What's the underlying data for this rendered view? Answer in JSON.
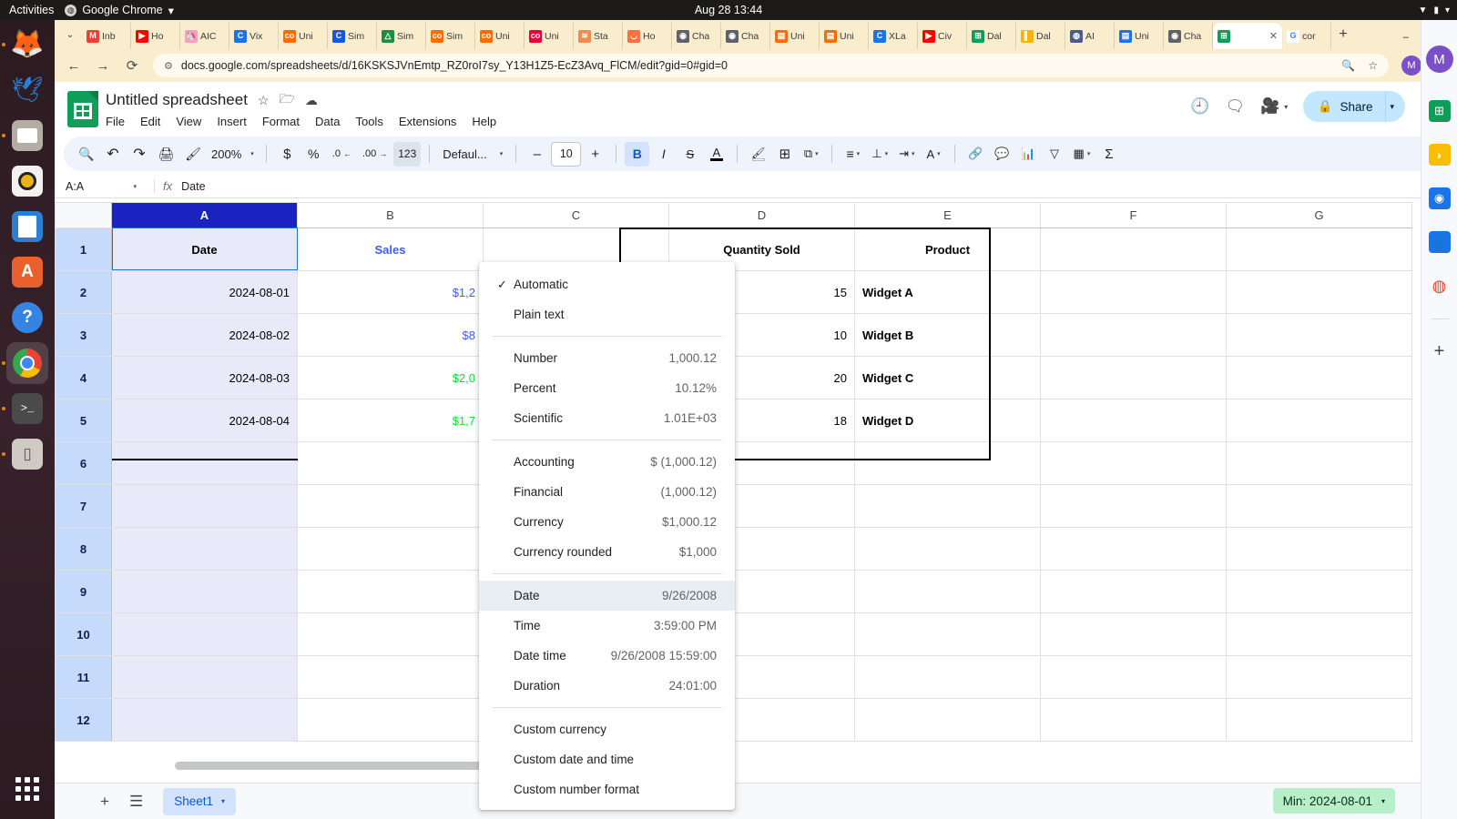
{
  "gnome": {
    "activities": "Activities",
    "app_name": "Google Chrome",
    "app_caret": "▾",
    "clock": "Aug 28  13:44",
    "tray": [
      "▼",
      "▮",
      "▾"
    ]
  },
  "dock": {
    "items": [
      {
        "name": "firefox-icon",
        "glyph": "🦊",
        "running": true,
        "active": false
      },
      {
        "name": "thunderbird-icon",
        "glyph": "🕊",
        "running": false,
        "active": false
      },
      {
        "name": "files-icon",
        "glyph": "📁",
        "running": true,
        "active": false
      },
      {
        "name": "rhythmbox-icon",
        "glyph": "◎",
        "running": false,
        "active": false
      },
      {
        "name": "libreoffice-writer-icon",
        "glyph": "📄",
        "running": false,
        "active": false
      },
      {
        "name": "ubuntu-software-icon",
        "glyph": "A",
        "running": false,
        "active": false
      },
      {
        "name": "help-icon",
        "glyph": "?",
        "running": false,
        "active": false
      },
      {
        "name": "google-chrome-icon",
        "glyph": "◍",
        "running": true,
        "active": true
      },
      {
        "name": "terminal-icon",
        "glyph": ">_",
        "running": true,
        "active": false
      },
      {
        "name": "archive-manager-icon",
        "glyph": "🗜",
        "running": true,
        "active": false
      }
    ],
    "show_apps_label": "Show Applications"
  },
  "browser": {
    "tab_search_glyph": "⌄",
    "tabs": [
      {
        "label": "Inb",
        "fav": "M",
        "color": "#ea4335",
        "active": false
      },
      {
        "label": "Ho",
        "fav": "▶",
        "color": "#ff0000",
        "active": false
      },
      {
        "label": "AIC",
        "fav": "🦄",
        "color": "#f5a0c0",
        "active": false
      },
      {
        "label": "Vix",
        "fav": "C",
        "color": "#1a73e8",
        "active": false
      },
      {
        "label": "Uni",
        "fav": "co",
        "color": "#ff6d00",
        "active": false
      },
      {
        "label": "Sim",
        "fav": "C",
        "color": "#1a56db",
        "active": false
      },
      {
        "label": "Sim",
        "fav": "△",
        "color": "#1e8e3e",
        "active": false
      },
      {
        "label": "Sim",
        "fav": "co",
        "color": "#ff6d00",
        "active": false
      },
      {
        "label": "Uni",
        "fav": "co",
        "color": "#ff6d00",
        "active": false
      },
      {
        "label": "Uni",
        "fav": "co",
        "color": "#e8003c",
        "active": false
      },
      {
        "label": "Sta",
        "fav": "≋",
        "color": "#f28b50",
        "active": false
      },
      {
        "label": "Ho",
        "fav": "◡",
        "color": "#ff7043",
        "active": false
      },
      {
        "label": "Cha",
        "fav": "◉",
        "color": "#5f6368",
        "active": false
      },
      {
        "label": "Cha",
        "fav": "◉",
        "color": "#5f6368",
        "active": false
      },
      {
        "label": "Uni",
        "fav": "▤",
        "color": "#ff6d00",
        "active": false
      },
      {
        "label": "Uni",
        "fav": "▤",
        "color": "#ff6d00",
        "active": false
      },
      {
        "label": "XLa",
        "fav": "C",
        "color": "#1a73e8",
        "active": false
      },
      {
        "label": "Civ",
        "fav": "▶",
        "color": "#ff0000",
        "active": false
      },
      {
        "label": "Dal",
        "fav": "⊞",
        "color": "#0f9d58",
        "active": false
      },
      {
        "label": "Dal",
        "fav": "▌",
        "color": "#f4b400",
        "active": false
      },
      {
        "label": "AI ",
        "fav": "◍",
        "color": "#4a5b8c",
        "active": false
      },
      {
        "label": "Uni",
        "fav": "▤",
        "color": "#1a73e8",
        "active": false
      },
      {
        "label": "Cha",
        "fav": "◉",
        "color": "#5f6368",
        "active": false
      },
      {
        "label": "",
        "fav": "⊞",
        "color": "#0f9d58",
        "active": true
      },
      {
        "label": "cor",
        "fav": "G",
        "color": "#ffffff",
        "active": false
      }
    ],
    "active_tab_close": "✕",
    "new_tab_glyph": "+",
    "window_buttons": [
      "–",
      "❐",
      "✕"
    ],
    "nav": {
      "back": "←",
      "forward": "→",
      "reload": "⟳",
      "site_info_icon": "site-info-icon",
      "url": "docs.google.com/spreadsheets/d/16KSKSJVnEmtp_RZ0roI7sy_Y13H1Z5-EcZ3Avq_FlCM/edit?gid=0#gid=0",
      "zoom_icon": "🔍",
      "bookmark_icon": "☆",
      "profile_initial": "M",
      "menu_glyph": "⋮"
    }
  },
  "sheets": {
    "doc_title": "Untitled spreadsheet",
    "title_icons": [
      {
        "name": "star-icon",
        "glyph": "☆"
      },
      {
        "name": "move-to-folder-icon",
        "glyph": "🗁"
      },
      {
        "name": "cloud-saved-icon",
        "glyph": "☁"
      }
    ],
    "menus": [
      "File",
      "Edit",
      "View",
      "Insert",
      "Format",
      "Data",
      "Tools",
      "Extensions",
      "Help"
    ],
    "header_right": {
      "version_history_icon": "🕘",
      "comment_icon": "🗨",
      "meet_icon": "🎥",
      "meet_caret": "▾",
      "share_lock_icon": "🔒",
      "share_label": "Share",
      "share_caret": "▾",
      "avatar_initial": "M"
    },
    "toolbar": {
      "search": "🔍",
      "undo": "↶",
      "redo": "↷",
      "print": "🖨",
      "paint_format": "🖌",
      "zoom_value": "200%",
      "zoom_caret": "▾",
      "currency": "$",
      "percent": "%",
      "decrease_decimal": ".0",
      "increase_decimal": ".00",
      "more_formats": "123",
      "font_family": "Defaul...",
      "font_caret": "▾",
      "font_decrease": "–",
      "font_size": "10",
      "font_increase": "+",
      "bold": "B",
      "italic": "I",
      "strikethrough": "S",
      "text_color": "A",
      "fill_color": "🖌",
      "borders": "⊞",
      "merge_cells": "⧉",
      "merge_caret": "▾",
      "h_align": "≡",
      "h_align_caret": "▾",
      "v_align": "⊥",
      "v_align_caret": "▾",
      "text_wrap": "⇥",
      "wrap_caret": "▾",
      "text_rotation": "A",
      "rotation_caret": "▾",
      "insert_link": "🔗",
      "insert_comment": "💬",
      "insert_chart": "📊",
      "create_filter": "▽",
      "functions_table": "▦",
      "table_caret": "▾",
      "sigma": "Σ",
      "collapse": "⌃"
    },
    "formula_bar": {
      "name_box": "A:A",
      "name_box_caret": "▾",
      "fx": "fx",
      "formula_value": "Date"
    },
    "grid": {
      "columns": [
        "A",
        "B",
        "C",
        "D",
        "E",
        "F",
        "G"
      ],
      "selected_column": "A",
      "rows": [
        "1",
        "2",
        "3",
        "4",
        "5",
        "6",
        "7",
        "8",
        "9",
        "10",
        "11",
        "12"
      ],
      "selected_rows": [
        "1",
        "2",
        "3",
        "4",
        "5",
        "6",
        "7",
        "8",
        "9",
        "10",
        "11",
        "12"
      ],
      "data": [
        {
          "row": "1",
          "A": "Date",
          "B": "Sales",
          "D": "Quantity Sold",
          "E": "Product"
        },
        {
          "row": "2",
          "A": "2024-08-01",
          "B": "$1,2",
          "D": "15",
          "E": "Widget A"
        },
        {
          "row": "3",
          "A": "2024-08-02",
          "B": "$8",
          "D": "10",
          "E": "Widget B"
        },
        {
          "row": "4",
          "A": "2024-08-03",
          "B": "$2,0",
          "D": "20",
          "E": "Widget C"
        },
        {
          "row": "5",
          "A": "2024-08-04",
          "B": "$1,7",
          "D": "18",
          "E": "Widget D"
        },
        {
          "row": "6",
          "A": "",
          "B": "",
          "D": "",
          "E": ""
        },
        {
          "row": "7",
          "A": "",
          "B": "",
          "D": "",
          "E": ""
        },
        {
          "row": "8",
          "A": "",
          "B": "",
          "D": "",
          "E": ""
        },
        {
          "row": "9",
          "A": "",
          "B": "",
          "D": "",
          "E": ""
        },
        {
          "row": "10",
          "A": "",
          "B": "",
          "D": "",
          "E": ""
        },
        {
          "row": "11",
          "A": "",
          "B": "",
          "D": "",
          "E": ""
        },
        {
          "row": "12",
          "A": "",
          "B": "",
          "D": "",
          "E": ""
        }
      ]
    },
    "bottom": {
      "add_sheet": "+",
      "all_sheets": "☰",
      "sheet_name": "Sheet1",
      "sheet_caret": "▾",
      "status_summary": "Min: 2024-08-01",
      "status_caret": "▾"
    }
  },
  "format_menu": {
    "items": [
      {
        "id": "automatic",
        "label": "Automatic",
        "sample": "",
        "checked": true,
        "selected": false
      },
      {
        "id": "plain-text",
        "label": "Plain text",
        "sample": "",
        "checked": false,
        "selected": false
      },
      {
        "id": "divider-1",
        "divider": true
      },
      {
        "id": "number",
        "label": "Number",
        "sample": "1,000.12",
        "checked": false,
        "selected": false
      },
      {
        "id": "percent",
        "label": "Percent",
        "sample": "10.12%",
        "checked": false,
        "selected": false
      },
      {
        "id": "scientific",
        "label": "Scientific",
        "sample": "1.01E+03",
        "checked": false,
        "selected": false
      },
      {
        "id": "divider-2",
        "divider": true
      },
      {
        "id": "accounting",
        "label": "Accounting",
        "sample": "$ (1,000.12)",
        "checked": false,
        "selected": false
      },
      {
        "id": "financial",
        "label": "Financial",
        "sample": "(1,000.12)",
        "checked": false,
        "selected": false
      },
      {
        "id": "currency",
        "label": "Currency",
        "sample": "$1,000.12",
        "checked": false,
        "selected": false
      },
      {
        "id": "currency-rounded",
        "label": "Currency rounded",
        "sample": "$1,000",
        "checked": false,
        "selected": false
      },
      {
        "id": "divider-3",
        "divider": true
      },
      {
        "id": "date",
        "label": "Date",
        "sample": "9/26/2008",
        "checked": false,
        "selected": true
      },
      {
        "id": "time",
        "label": "Time",
        "sample": "3:59:00 PM",
        "checked": false,
        "selected": false
      },
      {
        "id": "date-time",
        "label": "Date time",
        "sample": "9/26/2008 15:59:00",
        "checked": false,
        "selected": false
      },
      {
        "id": "duration",
        "label": "Duration",
        "sample": "24:01:00",
        "checked": false,
        "selected": false
      },
      {
        "id": "divider-4",
        "divider": true
      },
      {
        "id": "custom-currency",
        "label": "Custom currency",
        "sample": "",
        "checked": false,
        "selected": false
      },
      {
        "id": "custom-date-time",
        "label": "Custom date and time",
        "sample": "",
        "checked": false,
        "selected": false
      },
      {
        "id": "custom-number",
        "label": "Custom number format",
        "sample": "",
        "checked": false,
        "selected": false
      }
    ],
    "check_glyph": "✓"
  },
  "side_panel": {
    "avatar_initial": "M",
    "icons": [
      {
        "name": "google-sheets-side-icon",
        "glyph": "⊞",
        "color": "#0f9d58"
      },
      {
        "name": "google-keep-side-icon",
        "glyph": "💡",
        "color": "#fbbc04"
      },
      {
        "name": "google-tasks-side-icon",
        "glyph": "◉",
        "color": "#1a73e8"
      },
      {
        "name": "google-contacts-side-icon",
        "glyph": "👤",
        "color": "#1a73e8"
      },
      {
        "name": "google-maps-side-icon",
        "glyph": "📍",
        "color": "#ea4335"
      }
    ],
    "add_glyph": "+"
  },
  "colors": {
    "sheets_green": "#0f9d58",
    "selected_col_header": "#1a23c0",
    "selected_row_header": "#c6dafc",
    "selection_fill": "#e8eaf9",
    "sales_blue": "#3f5cf6",
    "sales_green": "#00e53d",
    "share_blue": "#c2e7ff",
    "status_chip_green": "#b7f0c8",
    "tabstrip_cream": "#faedcd"
  }
}
